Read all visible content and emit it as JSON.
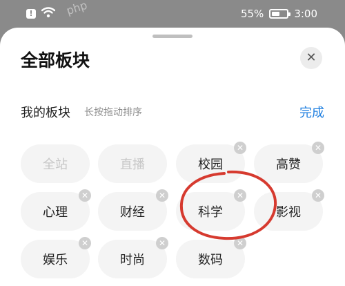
{
  "status_bar": {
    "battery": "55%",
    "battery_level": 0.55,
    "time": "3:00",
    "watermark": "php"
  },
  "sheet": {
    "title": "全部板块",
    "section_title": "我的板块",
    "section_hint": "长按拖动排序",
    "done_label": "完成",
    "close_icon": "close-icon"
  },
  "chips": [
    {
      "label": "全站",
      "removable": false,
      "disabled": true
    },
    {
      "label": "直播",
      "removable": false,
      "disabled": true
    },
    {
      "label": "校园",
      "removable": true,
      "disabled": false
    },
    {
      "label": "高赞",
      "removable": true,
      "disabled": false
    },
    {
      "label": "心理",
      "removable": true,
      "disabled": false
    },
    {
      "label": "财经",
      "removable": true,
      "disabled": false
    },
    {
      "label": "科学",
      "removable": true,
      "disabled": false
    },
    {
      "label": "影视",
      "removable": true,
      "disabled": false
    },
    {
      "label": "娱乐",
      "removable": true,
      "disabled": false
    },
    {
      "label": "时尚",
      "removable": true,
      "disabled": false
    },
    {
      "label": "数码",
      "removable": true,
      "disabled": false
    }
  ],
  "colors": {
    "accent": "#1f7fe0",
    "annotation": "#d63a2f"
  }
}
